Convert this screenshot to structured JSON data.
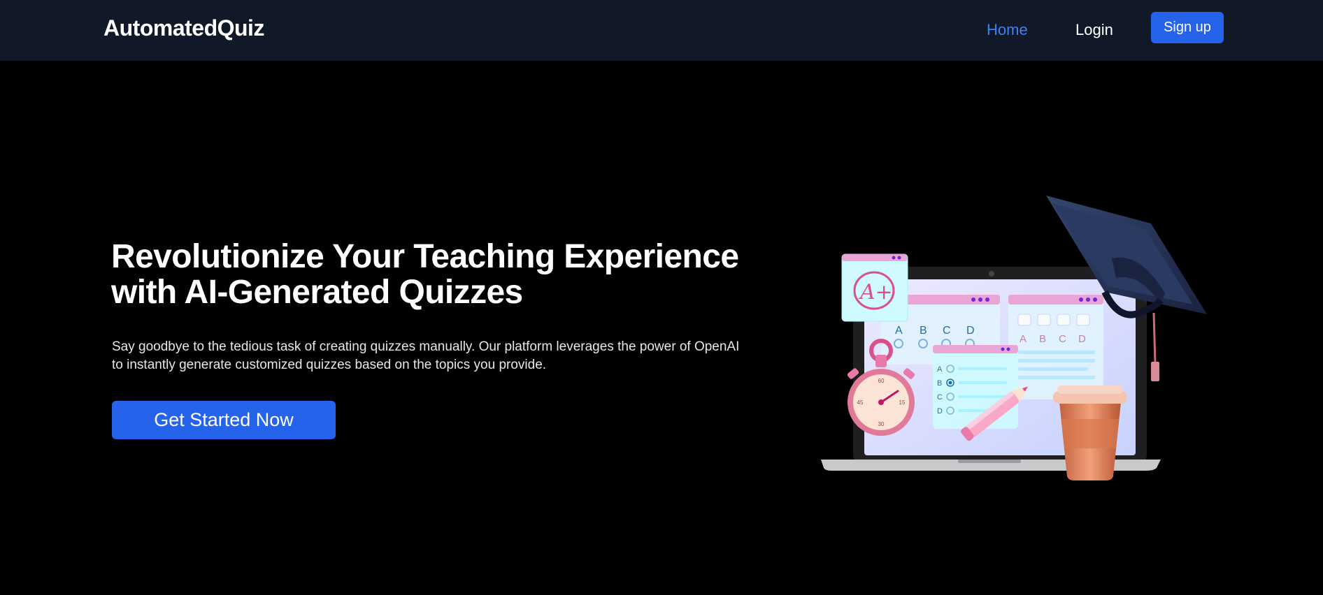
{
  "nav": {
    "brand": "AutomatedQuiz",
    "links": [
      {
        "label": "Home",
        "active": true
      },
      {
        "label": "Login",
        "active": false
      }
    ],
    "signup_label": "Sign up"
  },
  "hero": {
    "title": "Revolutionize Your Teaching Experience with AI-Generated Quizzes",
    "description": "Say goodbye to the tedious task of creating quizzes manually. Our platform leverages the power of OpenAI to instantly generate customized quizzes based on the topics you provide.",
    "cta_label": "Get Started Now"
  },
  "illustration": {
    "grade_label": "A+",
    "choice_letters": [
      "A",
      "B",
      "C",
      "D"
    ],
    "stopwatch_numbers": [
      "60",
      "15",
      "30",
      "45"
    ],
    "icon": "quiz-laptop-illustration"
  },
  "colors": {
    "nav_bg": "#111827",
    "page_bg": "#000000",
    "accent": "#2563eb",
    "active_link": "#3b82f6"
  }
}
